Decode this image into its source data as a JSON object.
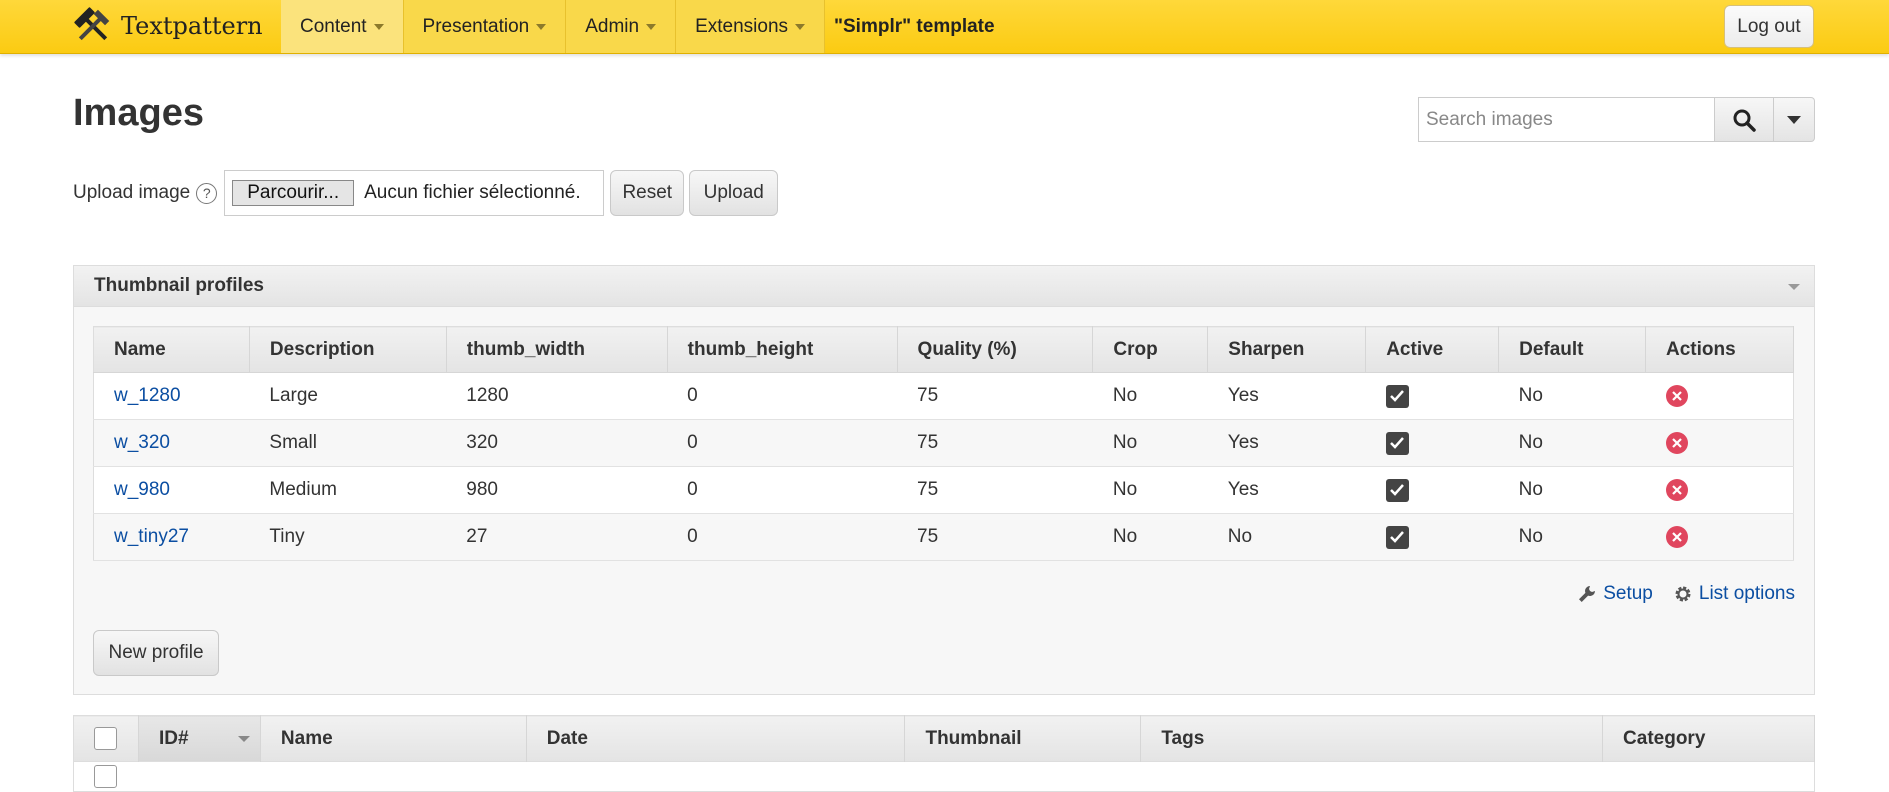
{
  "header": {
    "brand": "Textpattern",
    "nav": [
      {
        "label": "Content"
      },
      {
        "label": "Presentation"
      },
      {
        "label": "Admin"
      },
      {
        "label": "Extensions"
      }
    ],
    "site_name": "\"Simplr\" template",
    "logout": "Log out"
  },
  "page": {
    "title": "Images",
    "search_placeholder": "Search images"
  },
  "upload": {
    "label": "Upload image",
    "help": "?",
    "browse": "Parcourir...",
    "no_file": "Aucun fichier sélectionné.",
    "reset": "Reset",
    "upload": "Upload"
  },
  "thumbnail_profiles": {
    "title": "Thumbnail profiles",
    "columns": [
      "Name",
      "Description",
      "thumb_width",
      "thumb_height",
      "Quality (%)",
      "Crop",
      "Sharpen",
      "Active",
      "Default",
      "Actions"
    ],
    "rows": [
      {
        "name": "w_1280",
        "description": "Large",
        "width": "1280",
        "height": "0",
        "quality": "75",
        "crop": "No",
        "sharpen": "Yes",
        "active": true,
        "default": "No"
      },
      {
        "name": "w_320",
        "description": "Small",
        "width": "320",
        "height": "0",
        "quality": "75",
        "crop": "No",
        "sharpen": "Yes",
        "active": true,
        "default": "No"
      },
      {
        "name": "w_980",
        "description": "Medium",
        "width": "980",
        "height": "0",
        "quality": "75",
        "crop": "No",
        "sharpen": "Yes",
        "active": true,
        "default": "No"
      },
      {
        "name": "w_tiny27",
        "description": "Tiny",
        "width": "27",
        "height": "0",
        "quality": "75",
        "crop": "No",
        "sharpen": "No",
        "active": true,
        "default": "No"
      }
    ],
    "setup": "Setup",
    "list_options": "List options",
    "new_profile": "New profile"
  },
  "images_list": {
    "columns": [
      "ID#",
      "Name",
      "Date",
      "Thumbnail",
      "Tags",
      "Category"
    ]
  },
  "colors": {
    "header_yellow": "#fbcb12",
    "link_blue": "#0b4ea2",
    "delete_red": "#e0465e"
  }
}
